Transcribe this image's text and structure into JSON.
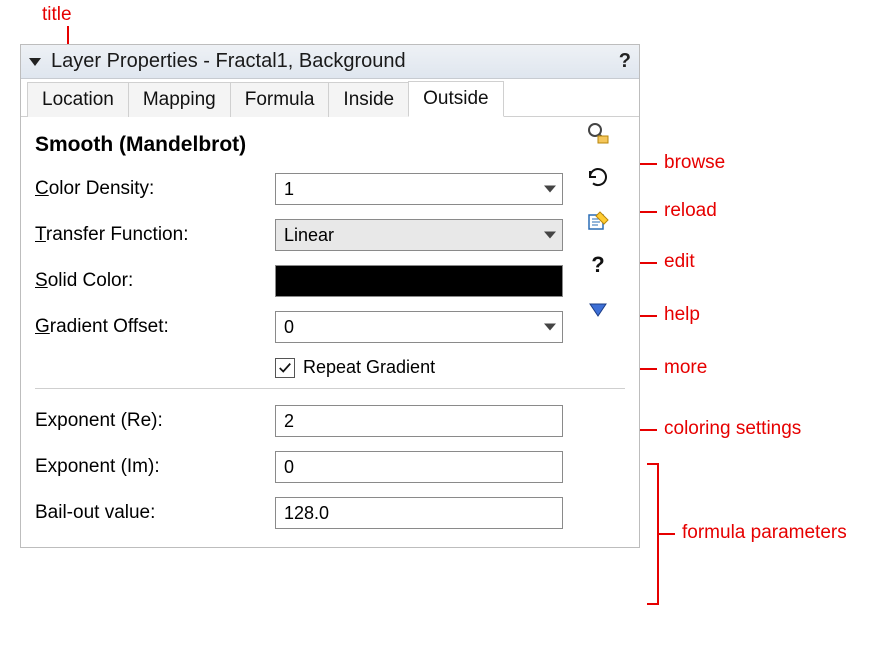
{
  "annotations": {
    "title": "title",
    "browse": "browse",
    "reload": "reload",
    "edit": "edit",
    "help": "help",
    "more": "more",
    "coloring_settings": "coloring settings",
    "formula_parameters": "formula parameters"
  },
  "titlebar": {
    "text": "Layer Properties - Fractal1, Background",
    "help": "?"
  },
  "tabs": {
    "items": [
      {
        "label": "Location",
        "active": false
      },
      {
        "label": "Mapping",
        "active": false
      },
      {
        "label": "Formula",
        "active": false
      },
      {
        "label": "Inside",
        "active": false
      },
      {
        "label": "Outside",
        "active": true
      }
    ]
  },
  "heading": "Smooth (Mandelbrot)",
  "coloring": {
    "color_density": {
      "label_pre": "C",
      "label_post": "olor Density:",
      "value": "1"
    },
    "transfer_function": {
      "label_pre": "T",
      "label_post": "ransfer Function:",
      "value": "Linear"
    },
    "solid_color": {
      "label_pre": "S",
      "label_post": "olid Color:",
      "value": "#000000"
    },
    "gradient_offset": {
      "label_pre": "G",
      "label_post": "radient Offset:",
      "value": "0"
    },
    "repeat_gradient": {
      "label_pre": "R",
      "label_post": "epeat Gradient",
      "checked": true
    }
  },
  "formula": {
    "exponent_re": {
      "label": "Exponent (Re):",
      "value": "2"
    },
    "exponent_im": {
      "label": "Exponent (Im):",
      "value": "0"
    },
    "bailout": {
      "label": "Bail-out value:",
      "value": "128.0"
    }
  },
  "side_icons": {
    "browse": "browse-icon",
    "reload": "reload-icon",
    "edit": "edit-icon",
    "help_q": "?",
    "more": "more-icon"
  }
}
